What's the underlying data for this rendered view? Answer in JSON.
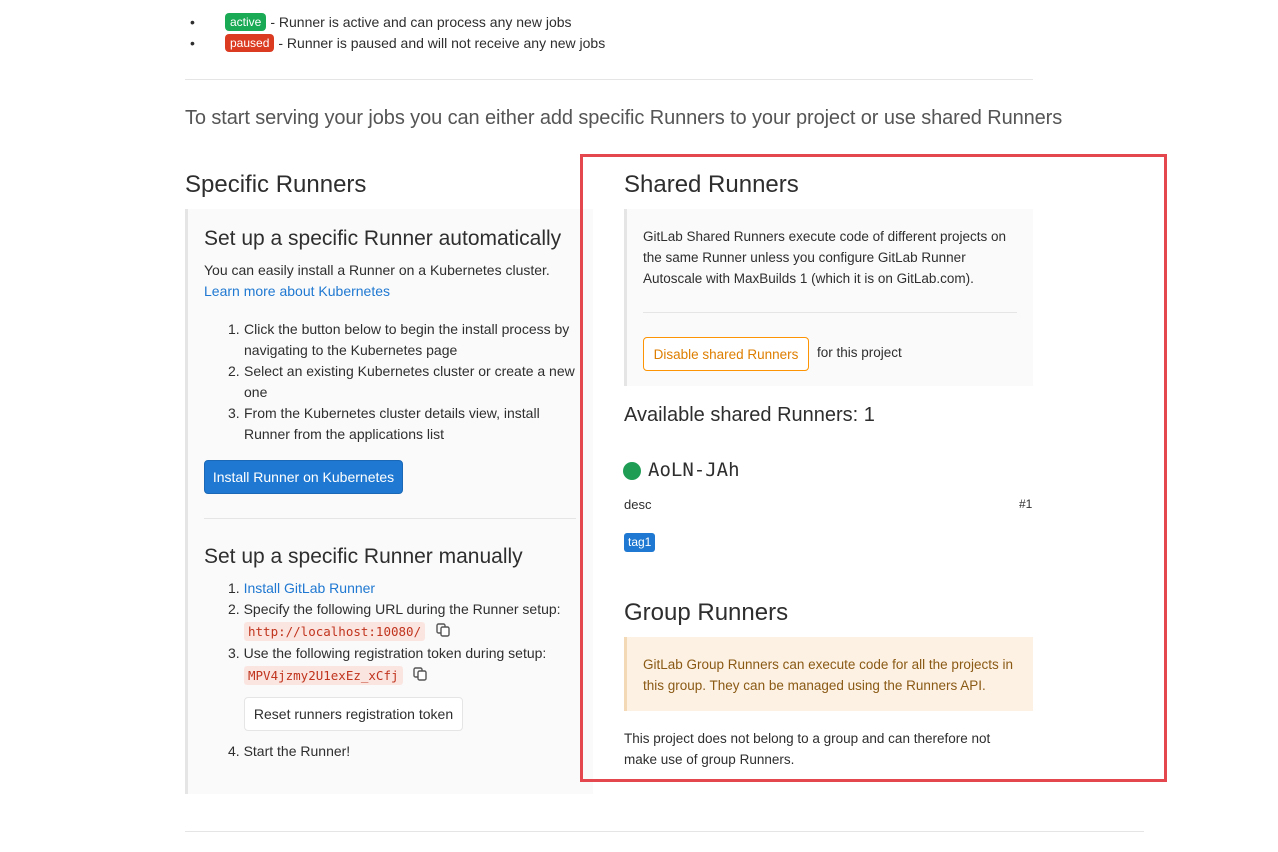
{
  "status_legend": [
    {
      "badge": "active",
      "description": "- Runner is active and can process any new jobs",
      "color": "#1aaa55"
    },
    {
      "badge": "paused",
      "description": "- Runner is paused and will not receive any new jobs",
      "color": "#db3b21"
    }
  ],
  "intro": "To start serving your jobs you can either add specific Runners to your project or use shared Runners",
  "specific": {
    "title": "Specific Runners",
    "auto": {
      "title": "Set up a specific Runner automatically",
      "desc": "You can easily install a Runner on a Kubernetes cluster.",
      "link": "Learn more about Kubernetes",
      "steps": [
        [
          "1.",
          "Click the button below to begin the install process by",
          "navigating to the Kubernetes page"
        ],
        [
          "2.",
          "Select an existing Kubernetes cluster or create a new",
          "one"
        ],
        [
          "3.",
          "From the Kubernetes cluster details view, install",
          "Runner from the applications list"
        ]
      ],
      "button": "Install Runner on Kubernetes"
    },
    "manual": {
      "title": "Set up a specific Runner manually",
      "step1_num": "1.",
      "step1_link": "Install GitLab Runner",
      "step2_num": "2.",
      "step2_text": "Specify the following URL during the Runner setup:",
      "url": "http://localhost:10080/",
      "step3_num": "3.",
      "step3_text": "Use the following registration token during setup:",
      "token": "MPV4jzmy2U1exEz_xCfj",
      "reset_button": "Reset runners registration token",
      "step4_num": "4.",
      "step4_text": "Start the Runner!"
    }
  },
  "shared": {
    "title": "Shared Runners",
    "info": "GitLab Shared Runners execute code of different projects on the same Runner unless you configure GitLab Runner Autoscale with MaxBuilds 1 (which it is on GitLab.com).",
    "disable_button": "Disable shared Runners",
    "for_project": "for this project",
    "available_title": "Available shared Runners: 1",
    "runner": {
      "name": "AoLN-JAh",
      "desc": "desc",
      "id": "#1",
      "tag": "tag1",
      "status_color": "#1f9d55"
    }
  },
  "group": {
    "title": "Group Runners",
    "info": "GitLab Group Runners can execute code for all the projects in this group. They can be managed using the Runners API.",
    "note": "This project does not belong to a group and can therefore not make use of group Runners."
  },
  "icons": {
    "copy": "copy-icon",
    "status": "status-dot-icon"
  }
}
